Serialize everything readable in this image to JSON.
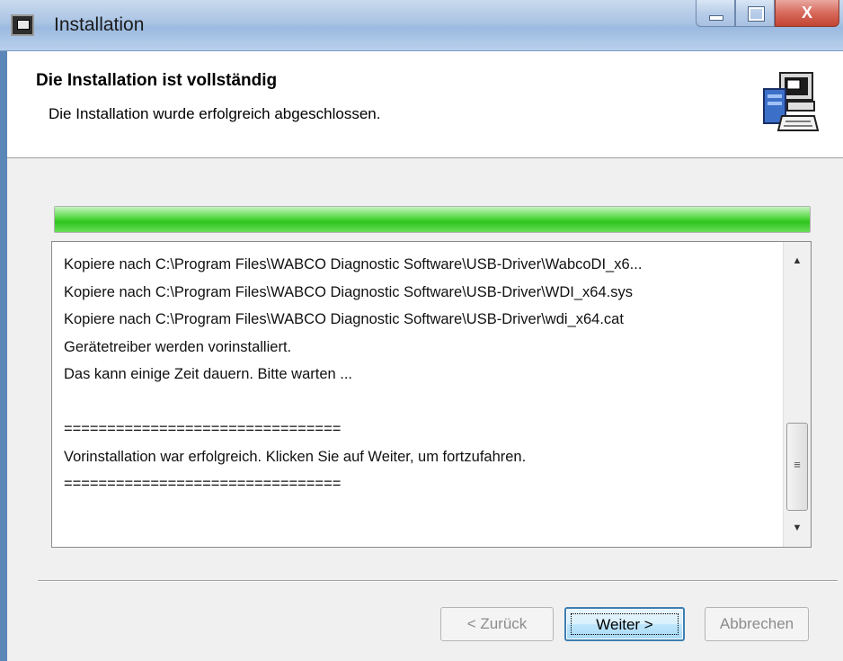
{
  "window": {
    "title": "Installation",
    "close_glyph": "X"
  },
  "header": {
    "title": "Die Installation ist vollständig",
    "subtitle": "Die Installation wurde erfolgreich abgeschlossen.",
    "icon": "setup-computer-icon"
  },
  "progress": {
    "value": 1.0,
    "color": "#2ec41c"
  },
  "log": {
    "lines": [
      "Kopiere nach C:\\Program Files\\WABCO Diagnostic Software\\USB-Driver\\WabcoDI_x6...",
      "Kopiere nach C:\\Program Files\\WABCO Diagnostic Software\\USB-Driver\\WDI_x64.sys",
      "Kopiere nach C:\\Program Files\\WABCO Diagnostic Software\\USB-Driver\\wdi_x64.cat",
      "Gerätetreiber werden vorinstalliert.",
      "Das kann einige Zeit dauern. Bitte warten ...",
      "",
      "================================",
      "Vorinstallation war erfolgreich. Klicken Sie auf Weiter, um fortzufahren.",
      "================================"
    ],
    "scroll_up_glyph": "▲",
    "scroll_down_glyph": "▼",
    "scroll_thumb_glyph": "≡"
  },
  "buttons": {
    "back_label": "< Zurück",
    "next_label": "Weiter >",
    "cancel_label": "Abbrechen"
  }
}
